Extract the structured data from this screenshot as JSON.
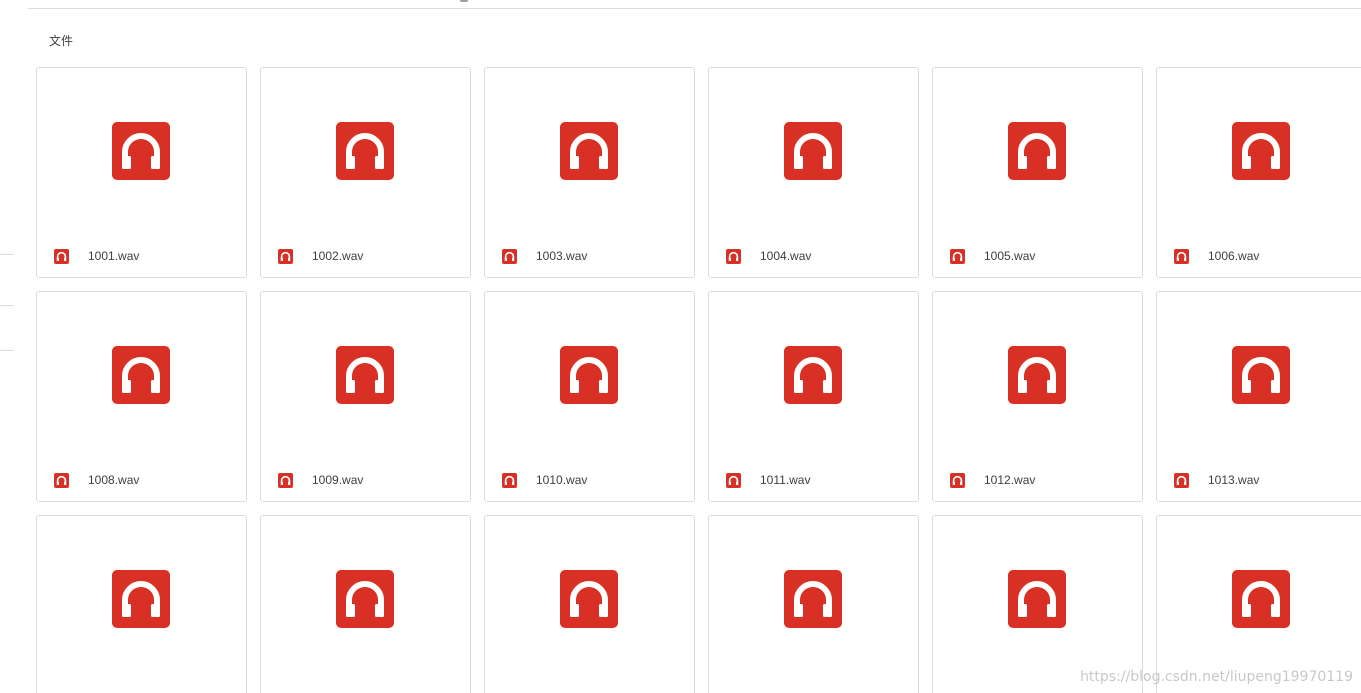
{
  "section": {
    "label": "文件"
  },
  "files": [
    {
      "name": "1001.wav",
      "icon": "headphones-icon"
    },
    {
      "name": "1002.wav",
      "icon": "headphones-icon"
    },
    {
      "name": "1003.wav",
      "icon": "headphones-icon"
    },
    {
      "name": "1004.wav",
      "icon": "headphones-icon"
    },
    {
      "name": "1005.wav",
      "icon": "headphones-icon"
    },
    {
      "name": "1006.wav",
      "icon": "headphones-icon"
    },
    {
      "name": "1008.wav",
      "icon": "headphones-icon"
    },
    {
      "name": "1009.wav",
      "icon": "headphones-icon"
    },
    {
      "name": "1010.wav",
      "icon": "headphones-icon"
    },
    {
      "name": "1011.wav",
      "icon": "headphones-icon"
    },
    {
      "name": "1012.wav",
      "icon": "headphones-icon"
    },
    {
      "name": "1013.wav",
      "icon": "headphones-icon"
    },
    {
      "name": "",
      "icon": "headphones-icon"
    },
    {
      "name": "",
      "icon": "headphones-icon"
    },
    {
      "name": "",
      "icon": "headphones-icon"
    },
    {
      "name": "",
      "icon": "headphones-icon"
    },
    {
      "name": "",
      "icon": "headphones-icon"
    },
    {
      "name": "",
      "icon": "headphones-icon"
    }
  ],
  "colors": {
    "audio_icon": "#d93025",
    "border": "#dadce0",
    "text": "#3c4043"
  },
  "watermark": "https://blog.csdn.net/liupeng19970119"
}
